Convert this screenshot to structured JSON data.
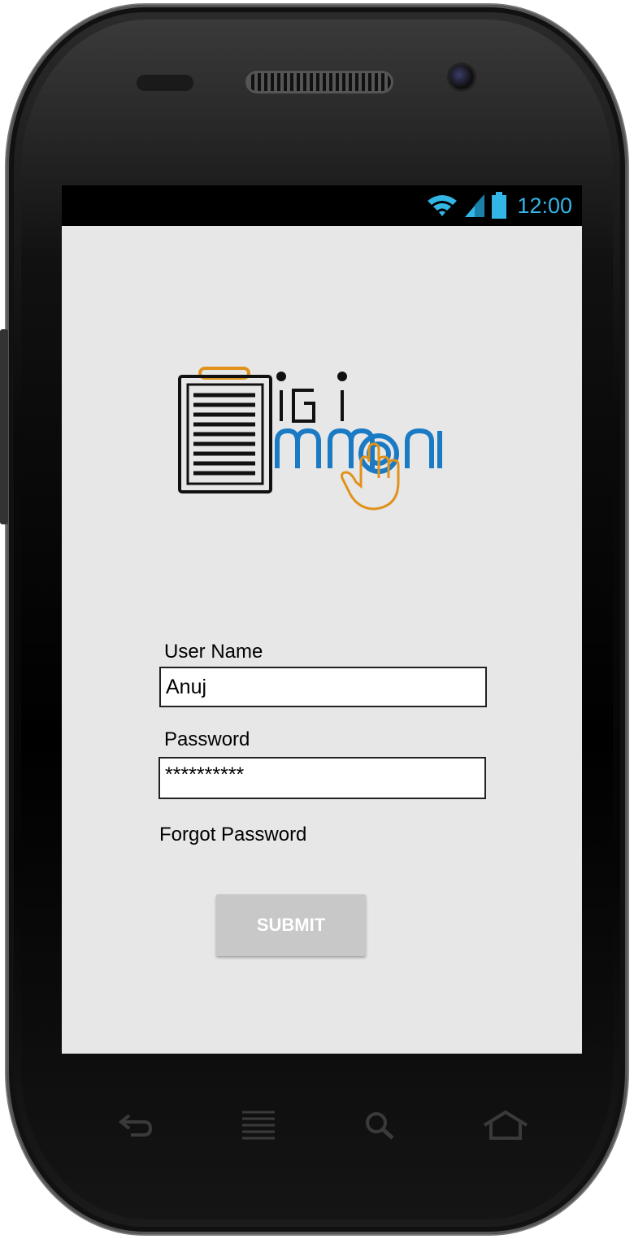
{
  "statusbar": {
    "time": "12:00",
    "icons": [
      "wifi-icon",
      "signal-icon",
      "battery-icon"
    ],
    "accent": "#33b5e5"
  },
  "logo": {
    "icon": "clipboard-hand-logo",
    "colors": {
      "dark": "#111111",
      "blue": "#1a7ac4",
      "orange": "#e0921c"
    }
  },
  "form": {
    "username_label": "User Name",
    "username_value": "Anuj",
    "password_label": "Password",
    "password_value": "**********",
    "forgot_label": "Forgot Password",
    "submit_label": "SUBMIT"
  },
  "navbar": {
    "icons": [
      "back-icon",
      "menu-icon",
      "search-icon",
      "home-icon"
    ]
  }
}
